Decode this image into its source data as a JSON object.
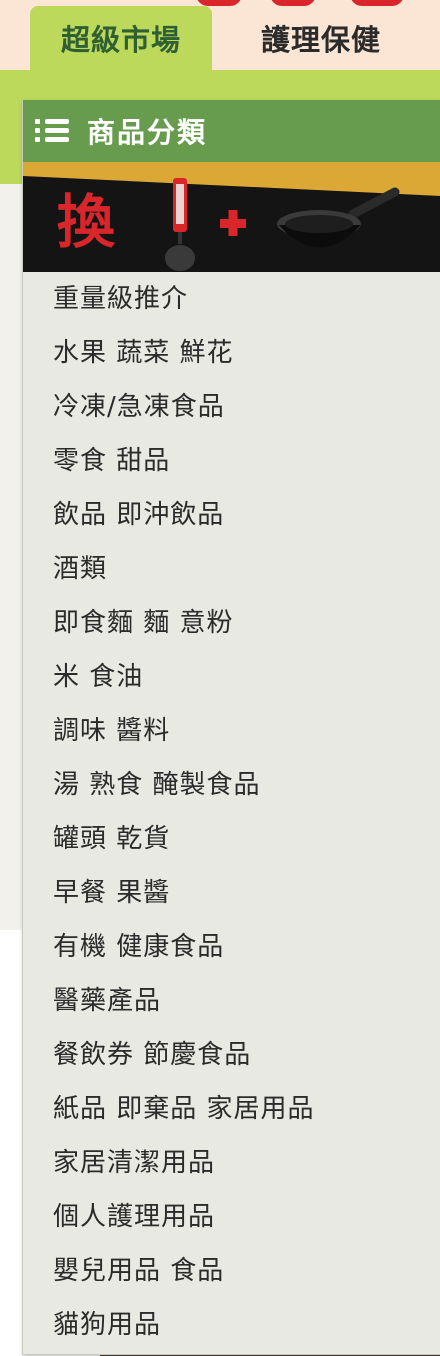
{
  "tabs": {
    "supermarket_label": "超級市場",
    "health_label": "護理保健"
  },
  "menu": {
    "title": "商品分類",
    "banner_text": "換",
    "items": [
      {
        "label": "重量級推介"
      },
      {
        "label": "水果 蔬菜 鮮花"
      },
      {
        "label": "冷凍/急凍食品"
      },
      {
        "label": "零食 甜品"
      },
      {
        "label": "飲品 即沖飲品"
      },
      {
        "label": "酒類"
      },
      {
        "label": "即食麵 麵 意粉"
      },
      {
        "label": "米 食油"
      },
      {
        "label": "調味 醬料"
      },
      {
        "label": "湯 熟食 醃製食品"
      },
      {
        "label": "罐頭 乾貨"
      },
      {
        "label": "早餐 果醬"
      },
      {
        "label": "有機 健康食品"
      },
      {
        "label": "醫藥產品"
      },
      {
        "label": "餐飲券 節慶食品"
      },
      {
        "label": "紙品 即棄品 家居用品"
      },
      {
        "label": "家居清潔用品"
      },
      {
        "label": "個人護理用品"
      },
      {
        "label": "嬰兒用品 食品"
      },
      {
        "label": "貓狗用品"
      }
    ]
  },
  "colors": {
    "header_green": "#679c4e",
    "band_green": "#bcd95b",
    "tab_text_green": "#2f5f33",
    "peach": "#fbe6d6",
    "accent_red": "#d8262b",
    "banner_gold": "#dba735"
  },
  "icons": {
    "menu_icon": "list-icon"
  }
}
